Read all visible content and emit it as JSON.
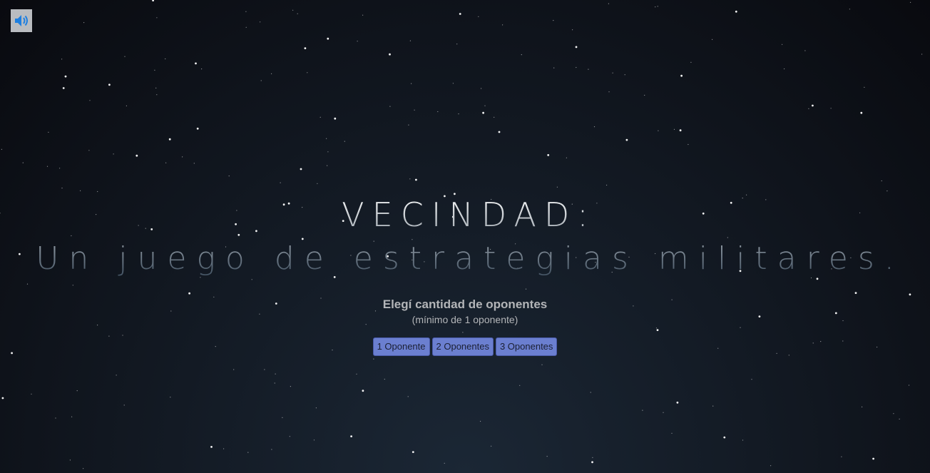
{
  "sound_button": {
    "icon": "speaker-icon",
    "color": "#1e7fe0"
  },
  "title": {
    "line1": "VECINDAD:",
    "line2": "Un juego de estrategias militares."
  },
  "prompt": {
    "main": "Elegí cantidad de oponentes",
    "sub": "(mínimo de 1 oponente)"
  },
  "options": [
    {
      "label": "1 Oponente"
    },
    {
      "label": "2 Oponentes"
    },
    {
      "label": "3 Oponentes"
    }
  ],
  "colors": {
    "background": "#090a0f",
    "button": "#6b7fd0",
    "text": "#b3b5b8"
  }
}
